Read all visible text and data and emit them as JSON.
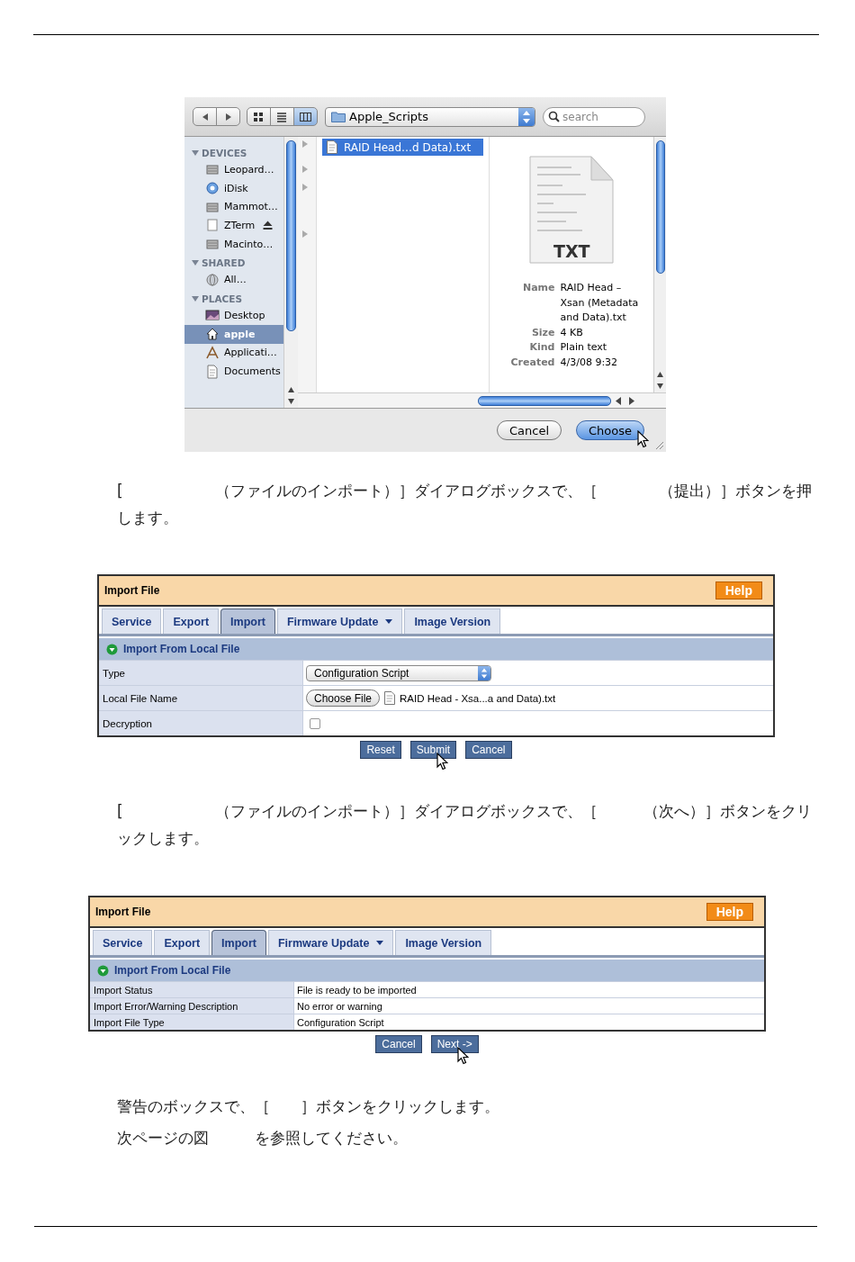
{
  "file_dialog": {
    "nav_buttons": [
      {
        "kind": "back"
      },
      {
        "kind": "forward"
      }
    ],
    "view_modes": [
      {
        "kind": "icons",
        "selected": false
      },
      {
        "kind": "list",
        "selected": false
      },
      {
        "kind": "columns",
        "selected": true
      }
    ],
    "location": "Apple_Scripts",
    "search": {
      "placeholder": "search"
    },
    "sidebar": [
      {
        "heading": "DEVICES",
        "expanded": true,
        "items": [
          {
            "label": "Leopard…",
            "kind": "disk",
            "selected": false,
            "eject": false
          },
          {
            "label": "iDisk",
            "kind": "idisk",
            "selected": false,
            "eject": false
          },
          {
            "label": "Mammot…",
            "kind": "disk",
            "selected": false,
            "eject": false
          },
          {
            "label": "ZTerm",
            "kind": "volume",
            "selected": false,
            "eject": true
          },
          {
            "label": "Macinto…",
            "kind": "disk",
            "selected": false,
            "eject": false
          }
        ]
      },
      {
        "heading": "SHARED",
        "expanded": true,
        "items": [
          {
            "label": "All…",
            "kind": "network",
            "selected": false,
            "eject": false
          }
        ]
      },
      {
        "heading": "PLACES",
        "expanded": true,
        "items": [
          {
            "label": "Desktop",
            "kind": "desktop",
            "selected": false,
            "eject": false
          },
          {
            "label": "apple",
            "kind": "home",
            "selected": true,
            "eject": false
          },
          {
            "label": "Applicati…",
            "kind": "apps",
            "selected": false,
            "eject": false
          },
          {
            "label": "Documents",
            "kind": "docs",
            "selected": false,
            "eject": false
          }
        ]
      }
    ],
    "files": [
      {
        "label": "RAID Head…d Data).txt",
        "selected": true
      }
    ],
    "preview": {
      "badge": "TXT",
      "info": [
        {
          "label": "Name",
          "value": "RAID Head – Xsan (Metadata and Data).txt"
        },
        {
          "label": "Size",
          "value": "4 KB"
        },
        {
          "label": "Kind",
          "value": "Plain text"
        },
        {
          "label": "Created",
          "value": "4/3/08 9:32"
        }
      ]
    },
    "buttons": [
      {
        "label": "Cancel",
        "default": false,
        "pointer": false
      },
      {
        "label": "Choose",
        "default": true,
        "pointer": true
      }
    ]
  },
  "paragraph_1": "[　　　　　　（ファイルのインポート）］ダイアログボックスで、［　　　　（提出）］ボタンを押します。",
  "import_panel_1": {
    "title": "Import File",
    "help": "Help",
    "tabs": [
      {
        "label": "Service",
        "selected": false,
        "dropdown": false
      },
      {
        "label": "Export",
        "selected": false,
        "dropdown": false
      },
      {
        "label": "Import",
        "selected": true,
        "dropdown": false
      },
      {
        "label": "Firmware Update",
        "selected": false,
        "dropdown": true
      },
      {
        "label": "Image Version",
        "selected": false,
        "dropdown": false
      }
    ],
    "section": "Import From Local File",
    "rows": [
      {
        "label": "Type",
        "kind": "select",
        "value": "Configuration Script"
      },
      {
        "label": "Local File Name",
        "kind": "file",
        "button": "Choose File",
        "value": "RAID Head - Xsa...a and Data).txt"
      },
      {
        "label": "Decryption",
        "kind": "checkbox",
        "checked": false
      }
    ],
    "buttons": [
      {
        "label": "Reset",
        "pointer": false
      },
      {
        "label": "Submit",
        "pointer": true
      },
      {
        "label": "Cancel",
        "pointer": false
      }
    ]
  },
  "paragraph_2": "[　　　　　　（ファイルのインポート）］ダイアログボックスで、［　　　（次へ）］ボタンをクリックします。",
  "import_panel_2": {
    "title": "Import File",
    "help": "Help",
    "tabs": [
      {
        "label": "Service",
        "selected": false,
        "dropdown": false
      },
      {
        "label": "Export",
        "selected": false,
        "dropdown": false
      },
      {
        "label": "Import",
        "selected": true,
        "dropdown": false
      },
      {
        "label": "Firmware Update",
        "selected": false,
        "dropdown": true
      },
      {
        "label": "Image Version",
        "selected": false,
        "dropdown": false
      }
    ],
    "section": "Import From Local File",
    "rows": [
      {
        "label": "Import Status",
        "kind": "text",
        "value": "File is ready to be imported"
      },
      {
        "label": "Import Error/Warning Description",
        "kind": "text",
        "value": "No error or warning"
      },
      {
        "label": "Import File Type",
        "kind": "text",
        "value": "Configuration Script"
      }
    ],
    "buttons": [
      {
        "label": "Cancel",
        "pointer": false
      },
      {
        "label": "Next ->",
        "pointer": true
      }
    ]
  },
  "paragraph_3": [
    "警告のボックスで、［　　］ボタンをクリックします。",
    "次ページの図　　　を参照してください。"
  ]
}
